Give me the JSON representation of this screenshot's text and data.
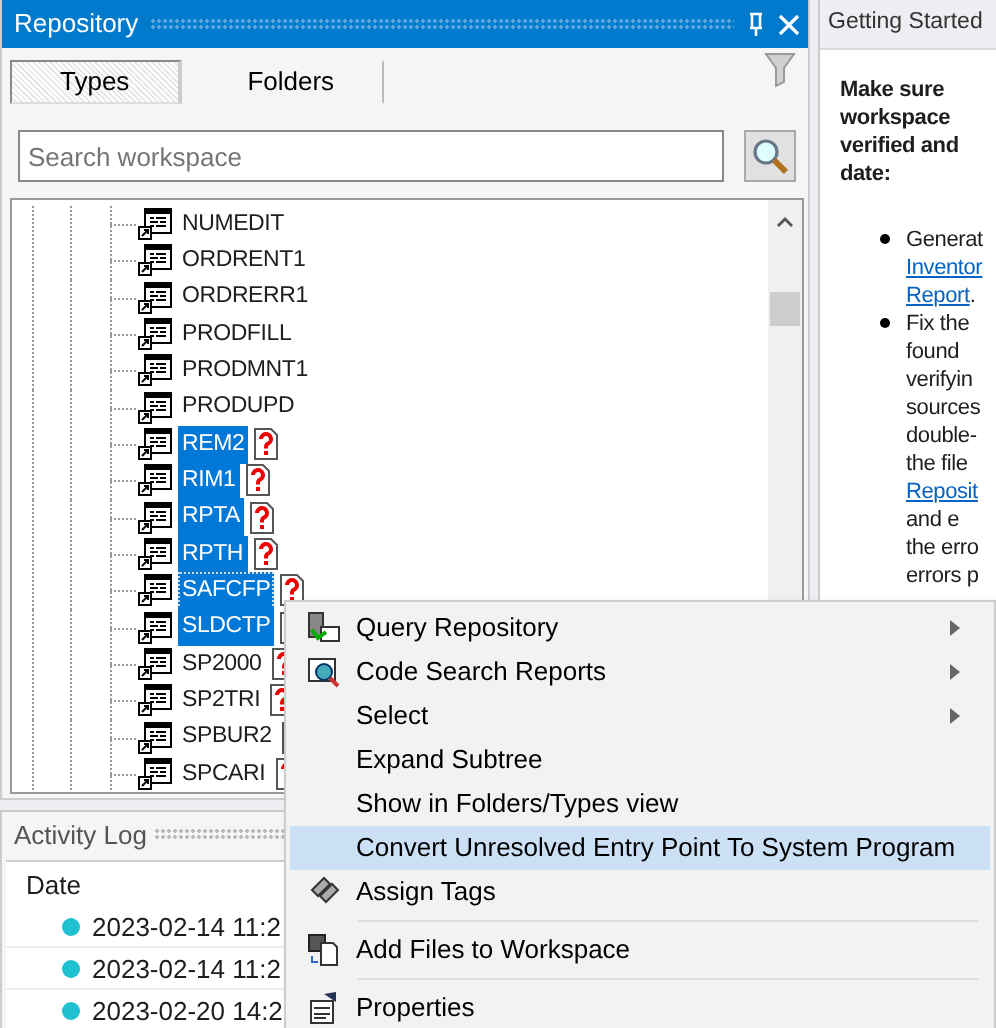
{
  "repository": {
    "title": "Repository",
    "tabs": [
      {
        "label": "Types",
        "selected": true
      },
      {
        "label": "Folders",
        "selected": false
      }
    ],
    "search": {
      "placeholder": "Search workspace"
    },
    "tree": [
      {
        "name": "NUMEDIT",
        "selected": false,
        "focused": false,
        "unresolved": false
      },
      {
        "name": "ORDRENT1",
        "selected": false,
        "focused": false,
        "unresolved": false
      },
      {
        "name": "ORDRERR1",
        "selected": false,
        "focused": false,
        "unresolved": false
      },
      {
        "name": "PRODFILL",
        "selected": false,
        "focused": false,
        "unresolved": false
      },
      {
        "name": "PRODMNT1",
        "selected": false,
        "focused": false,
        "unresolved": false
      },
      {
        "name": "PRODUPD",
        "selected": false,
        "focused": false,
        "unresolved": false
      },
      {
        "name": "REM2",
        "selected": true,
        "focused": false,
        "unresolved": true
      },
      {
        "name": "RIM1",
        "selected": true,
        "focused": false,
        "unresolved": true
      },
      {
        "name": "RPTA",
        "selected": true,
        "focused": false,
        "unresolved": true
      },
      {
        "name": "RPTH",
        "selected": true,
        "focused": false,
        "unresolved": true
      },
      {
        "name": "SAFCFP",
        "selected": true,
        "focused": true,
        "unresolved": true
      },
      {
        "name": "SLDCTP",
        "selected": true,
        "focused": false,
        "unresolved": true
      },
      {
        "name": "SP2000",
        "selected": false,
        "focused": false,
        "unresolved": true
      },
      {
        "name": "SP2TRI",
        "selected": false,
        "focused": false,
        "unresolved": true
      },
      {
        "name": "SPBUR2",
        "selected": false,
        "focused": false,
        "unresolved": true
      },
      {
        "name": "SPCARI",
        "selected": false,
        "focused": false,
        "unresolved": true
      }
    ]
  },
  "activity_log": {
    "title": "Activity Log",
    "columns": [
      "Date"
    ],
    "rows": [
      {
        "date": "2023-02-14 11:2",
        "color": "#1fc0d0"
      },
      {
        "date": "2023-02-14 11:2",
        "color": "#1fc0d0"
      },
      {
        "date": "2023-02-20 14:2",
        "color": "#1fc0d0"
      }
    ]
  },
  "getting_started": {
    "title": "Getting Started",
    "heading": [
      "Make sure",
      "workspace",
      "verified and",
      "date:"
    ],
    "bullets": [
      {
        "lines": [
          [
            {
              "text": "Generat",
              "link": false
            }
          ],
          [
            {
              "text": "Inventor",
              "link": true
            }
          ],
          [
            {
              "text": "Report",
              "link": true
            },
            {
              "text": ".",
              "link": false
            }
          ]
        ]
      },
      {
        "lines": [
          [
            {
              "text": "Fix the",
              "link": false
            }
          ],
          [
            {
              "text": "found",
              "link": false
            }
          ],
          [
            {
              "text": "verifyin",
              "link": false
            }
          ],
          [
            {
              "text": "sources",
              "link": false
            }
          ],
          [
            {
              "text": "double-",
              "link": false
            }
          ],
          [
            {
              "text": "the file",
              "link": false
            }
          ],
          [
            {
              "text": "Reposit",
              "link": true
            }
          ],
          [
            {
              "text": "and e",
              "link": false
            }
          ],
          [
            {
              "text": "the erro",
              "link": false
            }
          ],
          [
            {
              "text": "errors p",
              "link": false
            }
          ]
        ]
      }
    ]
  },
  "context_menu": [
    {
      "label": "Query Repository",
      "kind": "query",
      "submenu": true,
      "selected": false
    },
    {
      "label": "Code Search Reports",
      "kind": "codesearch",
      "submenu": true,
      "selected": false
    },
    {
      "label": "Select",
      "kind": "plain",
      "submenu": true,
      "selected": false
    },
    {
      "label": "Expand Subtree",
      "kind": "plain",
      "submenu": false,
      "selected": false
    },
    {
      "label": "Show in Folders/Types view",
      "kind": "plain",
      "submenu": false,
      "selected": false
    },
    {
      "label": "Convert Unresolved Entry Point To System Program",
      "kind": "plain",
      "submenu": false,
      "selected": true
    },
    {
      "label": "Assign Tags",
      "kind": "tags",
      "submenu": false,
      "selected": false
    },
    {
      "kind": "separator"
    },
    {
      "label": "Add Files to Workspace",
      "kind": "addfiles",
      "submenu": false,
      "selected": false
    },
    {
      "kind": "separator"
    },
    {
      "label": "Properties",
      "kind": "properties",
      "submenu": false,
      "selected": false
    }
  ]
}
